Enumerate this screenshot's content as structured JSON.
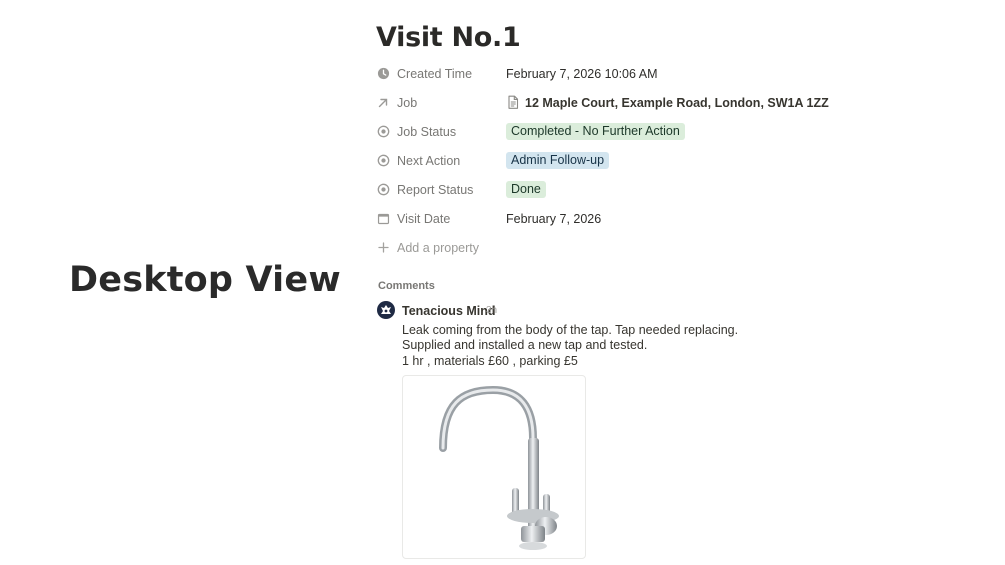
{
  "overlay": {
    "caption": "Desktop View"
  },
  "page": {
    "title": "Visit No.1"
  },
  "properties": [
    {
      "label": "Created Time",
      "value": "February 7, 2026 10:06 AM"
    },
    {
      "label": "Job",
      "value": "12 Maple Court, Example Road, London, SW1A 1ZZ"
    },
    {
      "label": "Job Status",
      "value": "Completed - No Further Action"
    },
    {
      "label": "Next Action",
      "value": "Admin Follow-up"
    },
    {
      "label": "Report Status",
      "value": "Done"
    },
    {
      "label": "Visit Date",
      "value": "February 7, 2026"
    }
  ],
  "add_property_label": "Add a property",
  "comments": {
    "header": "Comments",
    "items": [
      {
        "author": "Tenacious Mind",
        "time": "3h",
        "lines": [
          "Leak coming from the body of the tap. Tap needed replacing.",
          "Supplied and installed a new tap and tested.",
          "1 hr , materials £60 , parking £5"
        ]
      }
    ]
  },
  "colors": {
    "tag_green_bg": "#dbeddb",
    "tag_blue_bg": "#d3e5ef",
    "label_gray": "#787774"
  },
  "icons": {
    "created_time": "clock-icon",
    "job": "arrow-up-right-icon",
    "job_status": "status-icon",
    "next_action": "status-icon",
    "report_status": "status-icon",
    "visit_date": "calendar-icon",
    "job_value": "document-icon",
    "add_property": "plus-icon"
  }
}
